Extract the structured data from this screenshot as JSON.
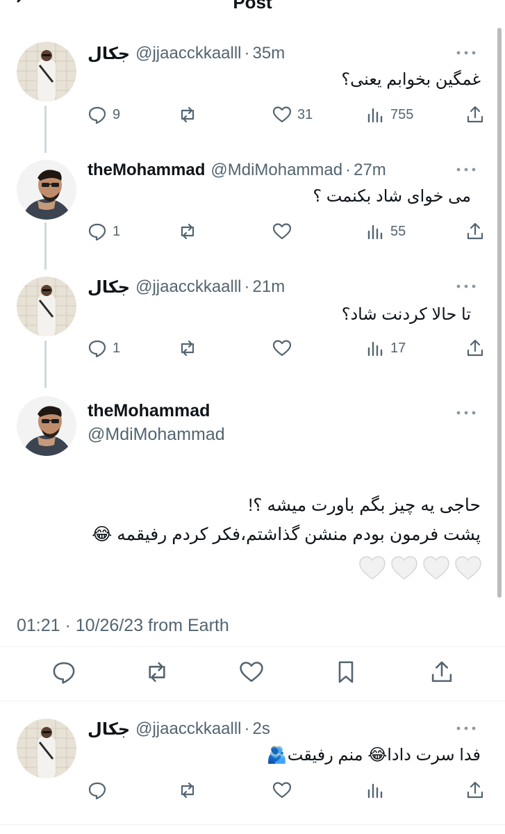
{
  "header": {
    "title": "Post"
  },
  "tweets": [
    {
      "name": "جکال",
      "handle": "@jjaacckkaalll",
      "time": "35m",
      "text": "غمگین بخوابم یعنی؟",
      "replies": "9",
      "retweets": "",
      "likes": "31",
      "views": "755"
    },
    {
      "name": "theMohammad",
      "handle": "@MdiMohammad",
      "time": "27m",
      "text": "می خوای شاد بکنمت ؟",
      "replies": "1",
      "retweets": "",
      "likes": "",
      "views": "55"
    },
    {
      "name": "جکال",
      "handle": "@jjaacckkaalll",
      "time": "21m",
      "text": "تا حالا کردنت شاد؟",
      "replies": "1",
      "retweets": "",
      "likes": "",
      "views": "17"
    }
  ],
  "main_tweet": {
    "name": "theMohammad",
    "handle": "@MdiMohammad",
    "line1": "حاجی یه چیز بگم باورت میشه ؟!",
    "line2": "پشت فرمون بودم منشن گذاشتم،فکر کردم رفیقمه 😂",
    "hearts": "🤍🤍🤍🤍",
    "meta": "01:21 · 10/26/23 from Earth"
  },
  "reply": {
    "name": "جکال",
    "handle": "@jjaacckkaalll",
    "time": "2s",
    "text": "فدا سرت دادا😂 منم رفیقت🫂",
    "replies": "",
    "retweets": "",
    "likes": "",
    "views": ""
  },
  "colors": {
    "text": "#0f1419",
    "secondary": "#536471",
    "thread_line": "#cfd9de",
    "divider": "#eff3f4"
  }
}
